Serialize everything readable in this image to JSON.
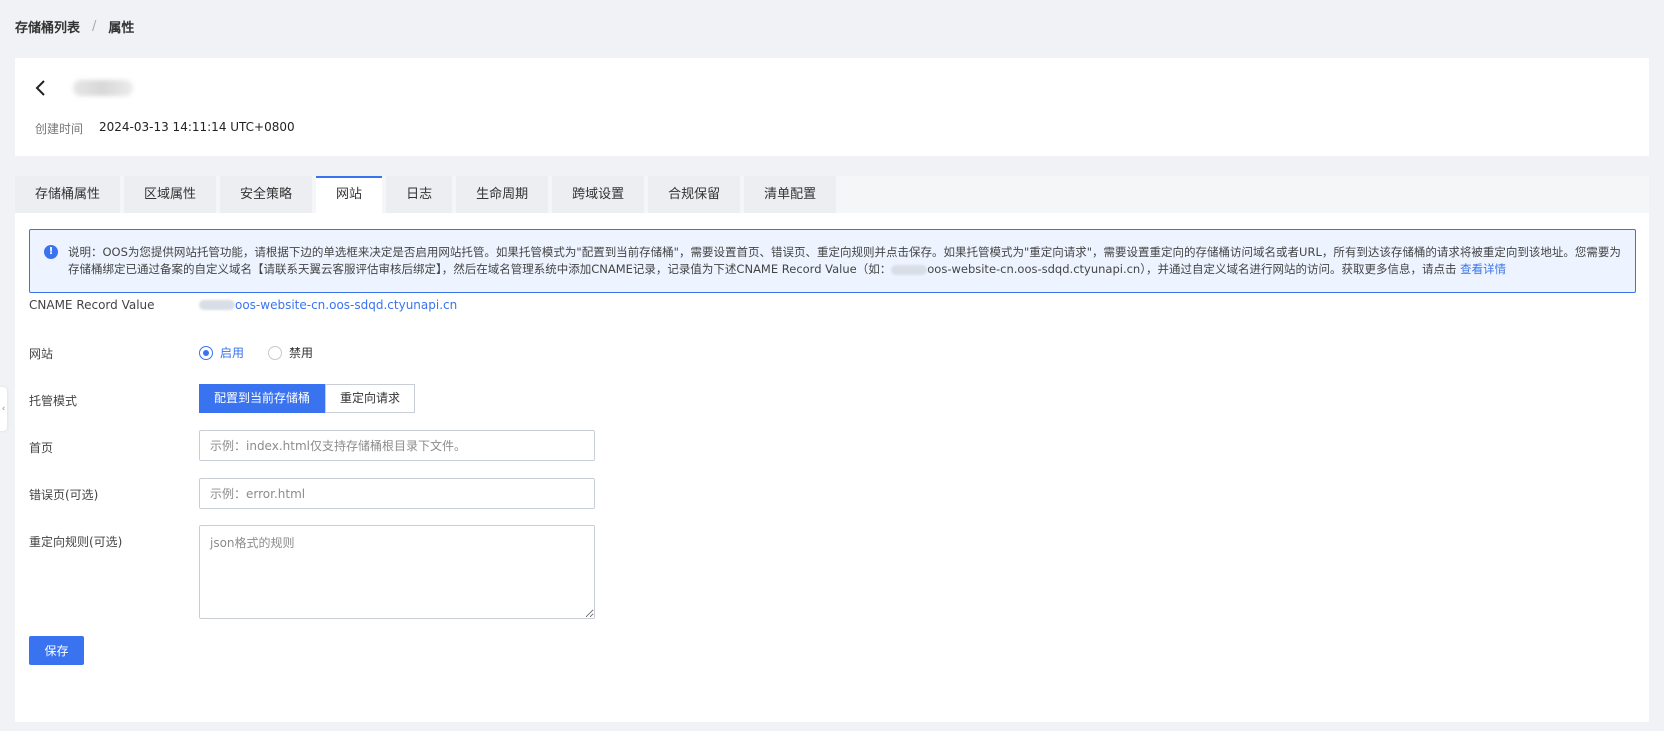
{
  "breadcrumb": {
    "items": [
      "存储桶列表",
      "属性"
    ],
    "separator": "/"
  },
  "header": {
    "created_label": "创建时间",
    "created_value": "2024-03-13 14:11:14 UTC+0800"
  },
  "tabs": [
    {
      "label": "存储桶属性",
      "active": false
    },
    {
      "label": "区域属性",
      "active": false
    },
    {
      "label": "安全策略",
      "active": false
    },
    {
      "label": "网站",
      "active": true
    },
    {
      "label": "日志",
      "active": false
    },
    {
      "label": "生命周期",
      "active": false
    },
    {
      "label": "跨域设置",
      "active": false
    },
    {
      "label": "合规保留",
      "active": false
    },
    {
      "label": "清单配置",
      "active": false
    }
  ],
  "notice": {
    "line1": "说明：OOS为您提供网站托管功能，请根据下边的单选框来决定是否启用网站托管。如果托管模式为\"配置到当前存储桶\"，需要设置首页、错误页、重定向规则并点击保存。如果托管模式为\"重定向请求\"，需要设置重定向的存储桶访问域名或者URL，所有到达该存储桶的请求将被重定向到该地",
    "line2_a": "址。您需要为存储桶绑定已通过备案的自定义域名【请联系天翼云客服评估审核后绑定】，然后在域名管理系统中添加CNAME记录，记录值为下述CNAME Record Value（如：",
    "line2_b": "oos-website-cn.oos-sdqd.ctyunapi.cn），并通过自定义域名进行网站的访问。获取更多信息，请点击 ",
    "link": "查看详情"
  },
  "form": {
    "cname_label": "CNAME Record Value",
    "cname_value": "oos-website-cn.oos-sdqd.ctyunapi.cn",
    "website_label": "网站",
    "website_options": [
      "启用",
      "禁用"
    ],
    "website_selected": "启用",
    "mode_label": "托管模式",
    "mode_options": [
      "配置到当前存储桶",
      "重定向请求"
    ],
    "mode_selected": "配置到当前存储桶",
    "index_label": "首页",
    "index_placeholder": "示例：index.html仅支持存储桶根目录下文件。",
    "error_label": "错误页(可选)",
    "error_placeholder": "示例：error.html",
    "redirect_label": "重定向规则(可选)",
    "redirect_placeholder": "json格式的规则",
    "save_label": "保存"
  },
  "colors": {
    "accent": "#3a73f0",
    "page_bg": "#f0f2f5"
  }
}
